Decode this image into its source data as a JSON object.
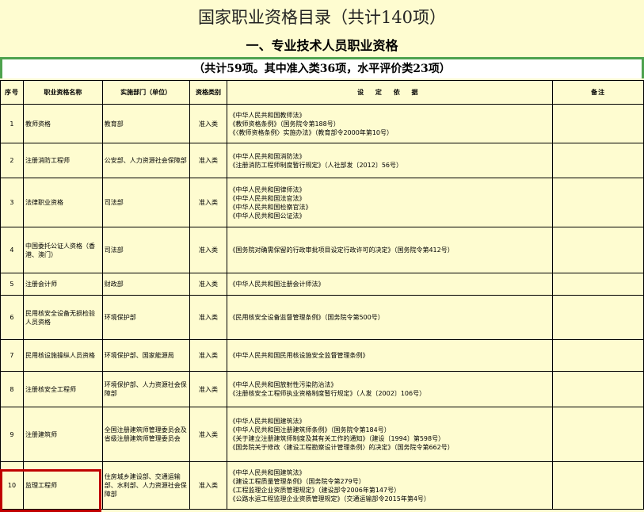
{
  "header": {
    "title": "国家职业资格目录（共计140项）",
    "section": "一、专业技术人员职业资格",
    "count": "（共计59项。其中准入类36项，水平评价类23项）"
  },
  "table": {
    "columns": [
      "序号",
      "职业资格名称",
      "实施部门（单位）",
      "资格类别",
      "设  定  依  据",
      "备注"
    ],
    "rows": [
      {
        "seq": "1",
        "name": "教师资格",
        "dept": "教育部",
        "cat": "准入类",
        "basis": [
          "《中华人民共和国教师法》",
          "《教师资格条例》（国务院令第188号）",
          "《〈教师资格条例〉实施办法》（教育部令2000年第10号）"
        ],
        "remark": ""
      },
      {
        "seq": "2",
        "name": "注册消防工程师",
        "dept": "公安部、人力资源社会保障部",
        "cat": "准入类",
        "basis": [
          "《中华人民共和国消防法》",
          "《注册消防工程师制度暂行规定》（人社部发〔2012〕56号）"
        ],
        "remark": ""
      },
      {
        "seq": "3",
        "name": "法律职业资格",
        "dept": "司法部",
        "cat": "准入类",
        "basis": [
          "《中华人民共和国律师法》",
          "《中华人民共和国法官法》",
          "《中华人民共和国检察官法》",
          "《中华人民共和国公证法》"
        ],
        "remark": ""
      },
      {
        "seq": "4",
        "name": "中国委托公证人资格（香港、澳门）",
        "dept": "司法部",
        "cat": "准入类",
        "basis": [
          "《国务院对确需保留的行政审批项目设定行政许可的决定》（国务院令第412号）"
        ],
        "remark": ""
      },
      {
        "seq": "5",
        "name": "注册会计师",
        "dept": "财政部",
        "cat": "准入类",
        "basis": [
          "《中华人民共和国注册会计师法》"
        ],
        "remark": ""
      },
      {
        "seq": "6",
        "name": "民用核安全设备无损检验人员资格",
        "dept": "环境保护部",
        "cat": "准入类",
        "basis": [
          "《民用核安全设备监督管理条例》（国务院令第500号）"
        ],
        "remark": ""
      },
      {
        "seq": "7",
        "name": "民用核设施操纵人员资格",
        "dept": "环境保护部、国家能源局",
        "cat": "准入类",
        "basis": [
          "《中华人民共和国民用核设施安全监督管理条例》"
        ],
        "remark": ""
      },
      {
        "seq": "8",
        "name": "注册核安全工程师",
        "dept": "环境保护部、人力资源社会保障部",
        "cat": "准入类",
        "basis": [
          "《中华人民共和国放射性污染防治法》",
          "《注册核安全工程师执业资格制度暂行规定》（人发〔2002〕106号）"
        ],
        "remark": ""
      },
      {
        "seq": "9",
        "name": "注册建筑师",
        "dept": "全国注册建筑师管理委员会及省级注册建筑师管理委员会",
        "cat": "准入类",
        "basis": [
          "《中华人民共和国建筑法》",
          "《中华人民共和国注册建筑师条例》（国务院令第184号）",
          "《关于建立注册建筑师制度及其有关工作的通知》（建设〔1994〕第598号）",
          "《国务院关于修改〈建设工程勘察设计管理条例〉的决定》（国务院令第662号）"
        ],
        "remark": ""
      },
      {
        "seq": "10",
        "name": "监理工程师",
        "dept": "住房城乡建设部、交通运输部、水利部、人力资源社会保障部",
        "cat": "准入类",
        "basis": [
          "《中华人民共和国建筑法》",
          "《建设工程质量管理条例》（国务院令第279号）",
          "《工程监理企业资质管理规定》（建设部令2006年第147号）",
          "《公路水运工程监理企业资质管理规定》（交通运输部令2015年第4号）"
        ],
        "remark": ""
      }
    ]
  },
  "colors": {
    "background": "#fefcd0",
    "rule_green": "#4ea24e",
    "highlight_red": "#c00000"
  }
}
